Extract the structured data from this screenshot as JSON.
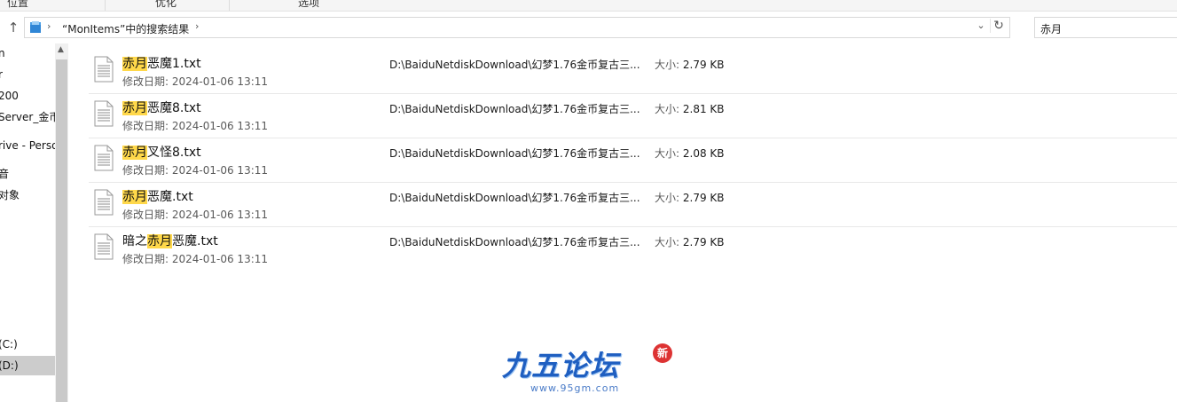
{
  "ribbon": {
    "tabs": [
      "位置",
      "优化",
      "选项"
    ]
  },
  "address": {
    "path": "“MonItems”中的搜索结果",
    "search_value": "赤月"
  },
  "nav": {
    "items": [
      {
        "label": "n",
        "selected": false
      },
      {
        "label": "r",
        "selected": false
      },
      {
        "label": "200",
        "selected": false
      },
      {
        "label": "Server_金币",
        "selected": false
      },
      {
        "label": "rive - Perso",
        "selected": false
      },
      {
        "label": "音",
        "selected": false
      },
      {
        "label": "对象",
        "selected": false
      },
      {
        "label": "(C:)",
        "selected": false
      },
      {
        "label": "(D:)",
        "selected": true
      }
    ]
  },
  "results": [
    {
      "name_pre": "",
      "name_hl": "赤月",
      "name_post": "恶魔1.txt",
      "date_label": "修改日期:",
      "date": "2024-01-06 13:11",
      "path": "D:\\BaiduNetdiskDownload\\幻梦1.76金币复古三...",
      "size_label": "大小:",
      "size": "2.79 KB"
    },
    {
      "name_pre": "",
      "name_hl": "赤月",
      "name_post": "恶魔8.txt",
      "date_label": "修改日期:",
      "date": "2024-01-06 13:11",
      "path": "D:\\BaiduNetdiskDownload\\幻梦1.76金币复古三...",
      "size_label": "大小:",
      "size": "2.81 KB"
    },
    {
      "name_pre": "",
      "name_hl": "赤月",
      "name_post": "叉怪8.txt",
      "date_label": "修改日期:",
      "date": "2024-01-06 13:11",
      "path": "D:\\BaiduNetdiskDownload\\幻梦1.76金币复古三...",
      "size_label": "大小:",
      "size": "2.08 KB"
    },
    {
      "name_pre": "",
      "name_hl": "赤月",
      "name_post": "恶魔.txt",
      "date_label": "修改日期:",
      "date": "2024-01-06 13:11",
      "path": "D:\\BaiduNetdiskDownload\\幻梦1.76金币复古三...",
      "size_label": "大小:",
      "size": "2.79 KB"
    },
    {
      "name_pre": "暗之",
      "name_hl": "赤月",
      "name_post": "恶魔.txt",
      "date_label": "修改日期:",
      "date": "2024-01-06 13:11",
      "path": "D:\\BaiduNetdiskDownload\\幻梦1.76金币复古三...",
      "size_label": "大小:",
      "size": "2.79 KB"
    }
  ],
  "watermark": {
    "title": "九五论坛",
    "url": "www.95gm.com",
    "stamp": "新"
  }
}
